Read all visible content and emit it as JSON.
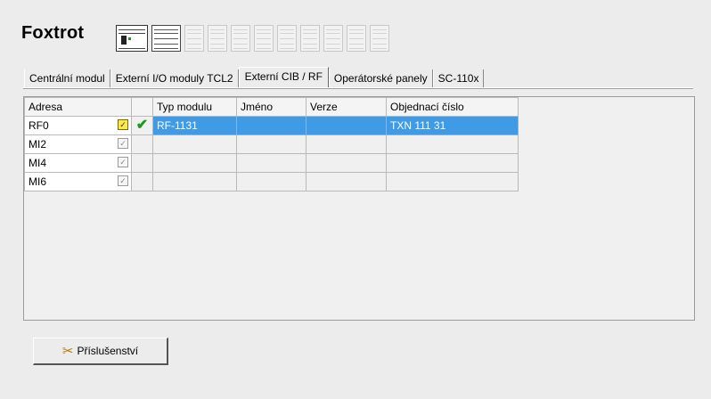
{
  "header": {
    "title": "Foxtrot"
  },
  "tabs": [
    {
      "label": "Centrální modul"
    },
    {
      "label": "Externí I/O moduly TCL2"
    },
    {
      "label": "Externí CIB / RF"
    },
    {
      "label": "Operátorské panely"
    },
    {
      "label": "SC-110x"
    }
  ],
  "active_tab": "Externí CIB / RF",
  "table": {
    "columns": [
      "Adresa",
      "",
      "Typ modulu",
      "Jméno",
      "Verze",
      "Objednací číslo"
    ],
    "rows": [
      {
        "address": "RF0",
        "checked": true,
        "status": "ok",
        "type": "RF-1131",
        "name": "",
        "version": "",
        "order": "TXN 111 31",
        "selected": true
      },
      {
        "address": "MI2",
        "checked": false,
        "status": "",
        "type": "",
        "name": "",
        "version": "",
        "order": ""
      },
      {
        "address": "MI4",
        "checked": false,
        "status": "",
        "type": "",
        "name": "",
        "version": "",
        "order": ""
      },
      {
        "address": "MI6",
        "checked": false,
        "status": "",
        "type": "",
        "name": "",
        "version": "",
        "order": ""
      }
    ]
  },
  "icons": {
    "status_ok": "checkmark-icon",
    "accessory": "tools-icon",
    "checkbox_on": "checkbox-checked-icon",
    "checkbox_off": "checkbox-unchecked-icon"
  },
  "colors": {
    "selection": "#3f9be6",
    "ok_check": "#1a9a1a",
    "checkbox_on": "#ffe84a"
  },
  "buttons": {
    "accessory_label": "Příslušenství"
  }
}
